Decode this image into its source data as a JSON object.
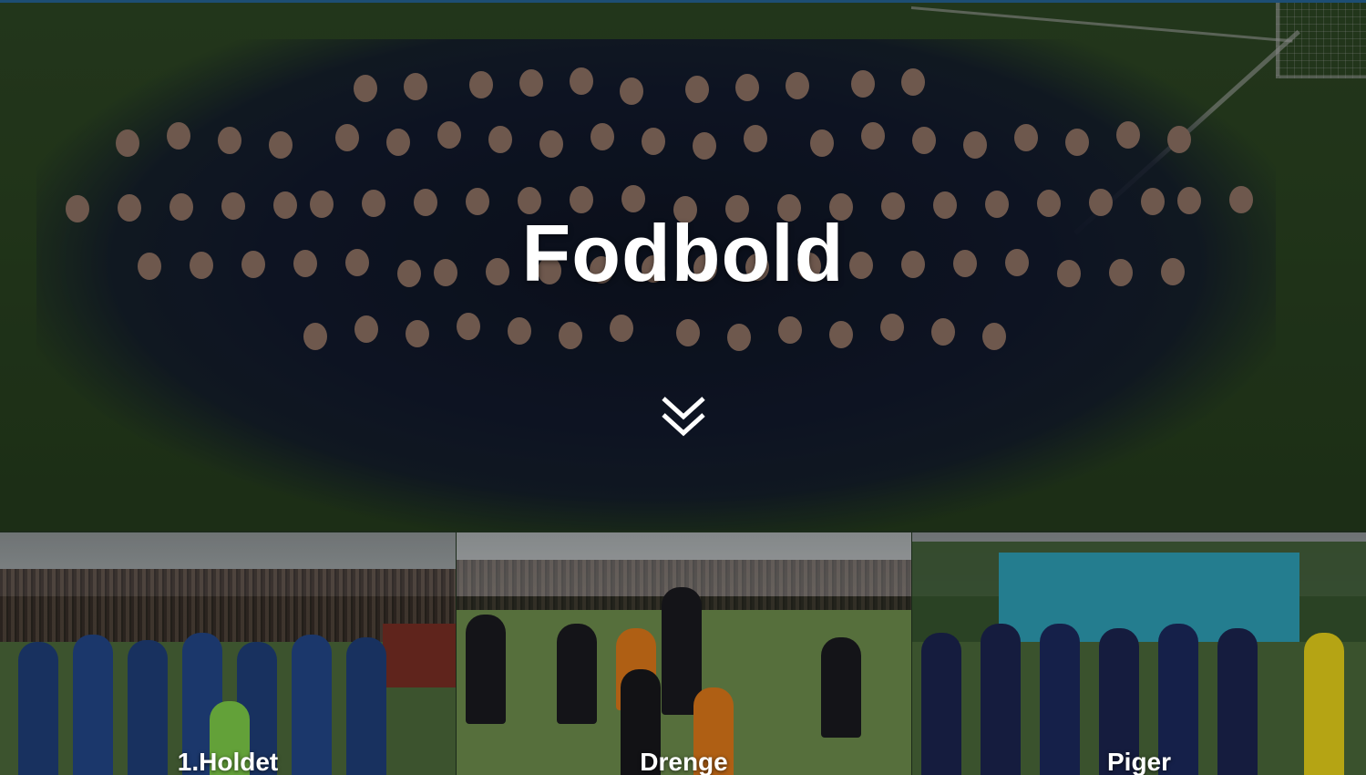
{
  "hero": {
    "title": "Fodbold",
    "scroll_icon": "double-chevron-down-icon",
    "image": "team-photo"
  },
  "tiles": [
    {
      "label": "1.Holdet",
      "image": "first-team-photo"
    },
    {
      "label": "Drenge",
      "image": "boys-training-photo"
    },
    {
      "label": "Piger",
      "image": "girls-team-photo"
    }
  ],
  "colors": {
    "title_text": "#ffffff",
    "top_line": "#1d4e74",
    "jersey_navy": "#17213a",
    "pitch_green": "#3a5a2e"
  }
}
